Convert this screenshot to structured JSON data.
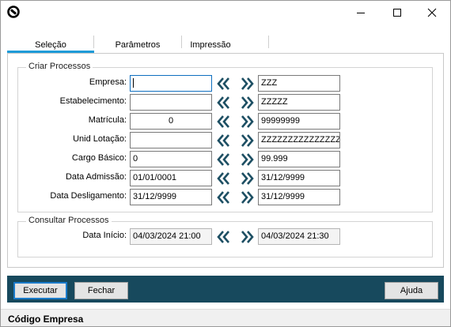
{
  "window": {
    "icon": "app-logo-icon"
  },
  "tabs": [
    {
      "label": "Seleção",
      "active": true
    },
    {
      "label": "Parâmetros",
      "active": false
    },
    {
      "label": "Impressão",
      "active": false
    }
  ],
  "criar": {
    "title": "Criar Processos",
    "rows": [
      {
        "label": "Empresa:",
        "from": "",
        "to": "ZZZ"
      },
      {
        "label": "Estabelecimento:",
        "from": "",
        "to": "ZZZZZ"
      },
      {
        "label": "Matrícula:",
        "from": "0",
        "to": "99999999"
      },
      {
        "label": "Unid Lotação:",
        "from": "",
        "to": "ZZZZZZZZZZZZZZZZZZZZ"
      },
      {
        "label": "Cargo Básico:",
        "from": "0",
        "to": "99.999"
      },
      {
        "label": "Data Admissão:",
        "from": "01/01/0001",
        "to": "31/12/9999"
      },
      {
        "label": "Data Desligamento:",
        "from": "31/12/9999",
        "to": "31/12/9999"
      }
    ]
  },
  "consultar": {
    "title": "Consultar Processos",
    "rows": [
      {
        "label": "Data Início:",
        "from": "04/03/2024 21:00",
        "to": "04/03/2024 21:30"
      }
    ]
  },
  "buttons": {
    "executar": "Executar",
    "fechar": "Fechar",
    "ajuda": "Ajuda"
  },
  "status": {
    "text": "Código Empresa"
  },
  "colors": {
    "accent": "#1f9bd8",
    "bottom_bar": "#17495d",
    "arrow": "#1d4f63"
  }
}
